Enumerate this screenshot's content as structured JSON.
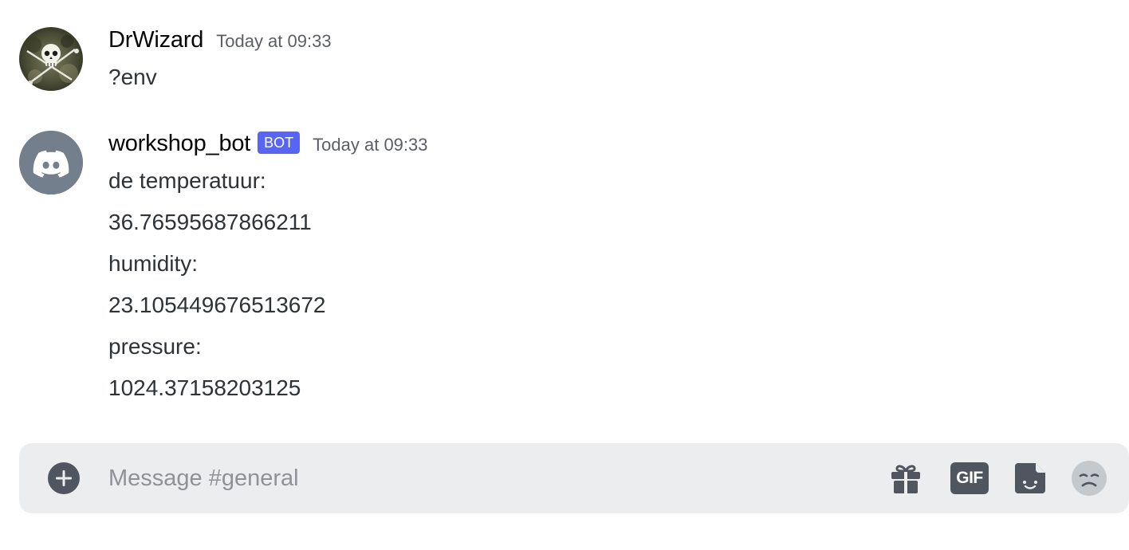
{
  "messages": [
    {
      "avatar_icon": "pirate-skull-avatar-icon",
      "username": "DrWizard",
      "timestamp": "Today at 09:33",
      "lines": [
        "?env"
      ]
    },
    {
      "avatar_icon": "discord-logo-icon",
      "username": "workshop_bot",
      "badge": "BOT",
      "timestamp": "Today at 09:33",
      "lines": [
        "de temperatuur:",
        "36.76595687866211",
        "humidity:",
        "23.105449676513672",
        "pressure:",
        "1024.37158203125"
      ]
    }
  ],
  "composer": {
    "placeholder": "Message #general",
    "value": "",
    "add_icon": "plus-circle-icon",
    "tools": [
      {
        "icon": "gift-icon"
      },
      {
        "icon": "gif-icon",
        "label": "GIF"
      },
      {
        "icon": "sticker-icon"
      },
      {
        "icon": "emoji-icon"
      }
    ]
  },
  "colors": {
    "bot_badge": "#5865f2",
    "discord_avatar_bg": "#747f8d",
    "composer_bg": "#ebedef",
    "icon_gray": "#4f5660"
  }
}
